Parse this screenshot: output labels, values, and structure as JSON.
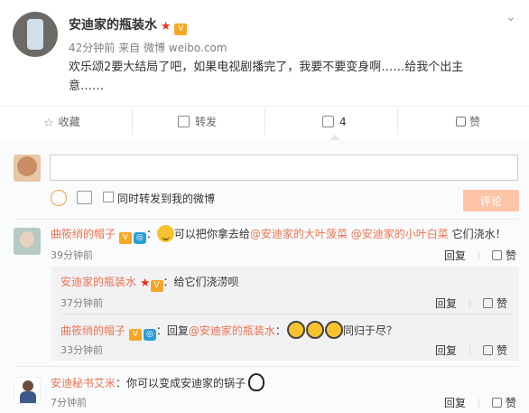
{
  "post": {
    "author": "安迪家的瓶装水",
    "time": "42分钟前",
    "source_prefix": "来自",
    "source": "微博 weibo.com",
    "text_line1": "欢乐颂2要大结局了吧，如果电视剧播完了，我要不要变身啊……给我个出主",
    "text_line2": "意……"
  },
  "actions": {
    "favorite": "收藏",
    "forward": "转发",
    "comment_count": "4",
    "like": "赞"
  },
  "compose": {
    "placeholder": "",
    "also_forward": "同时转发到我的微博",
    "submit": "评论"
  },
  "comments": [
    {
      "user": "曲筱绡的帽子",
      "colon": "：",
      "text_a": "可以把你拿去给",
      "mention1": "@安迪家的大叶菠菜",
      "mention2": "@安迪家的小叶白菜",
      "text_b": "它们浇水！",
      "time": "39分钟前",
      "reply": "回复",
      "like": "赞"
    },
    {
      "user": "安迪家的瓶装水",
      "colon": "：",
      "text": "给它们浇涝呗",
      "time": "37分钟前",
      "reply": "回复",
      "like": "赞"
    },
    {
      "user": "曲筱绡的帽子",
      "colon": "：",
      "text_a": "回复",
      "mention": "@安迪家的瓶装水",
      "text_b": "同归于尽？",
      "time": "33分钟前",
      "reply": "回复",
      "like": "赞"
    },
    {
      "user": "安迪秘书艾米",
      "colon": "：",
      "text": "你可以变成安迪家的锅子",
      "time": "7分钟前",
      "reply": "回复",
      "like": "赞"
    }
  ],
  "colors": {
    "link": "#eb7350",
    "submit_bg": "#fdc4a8",
    "nested_bg": "#f2f2f5"
  }
}
